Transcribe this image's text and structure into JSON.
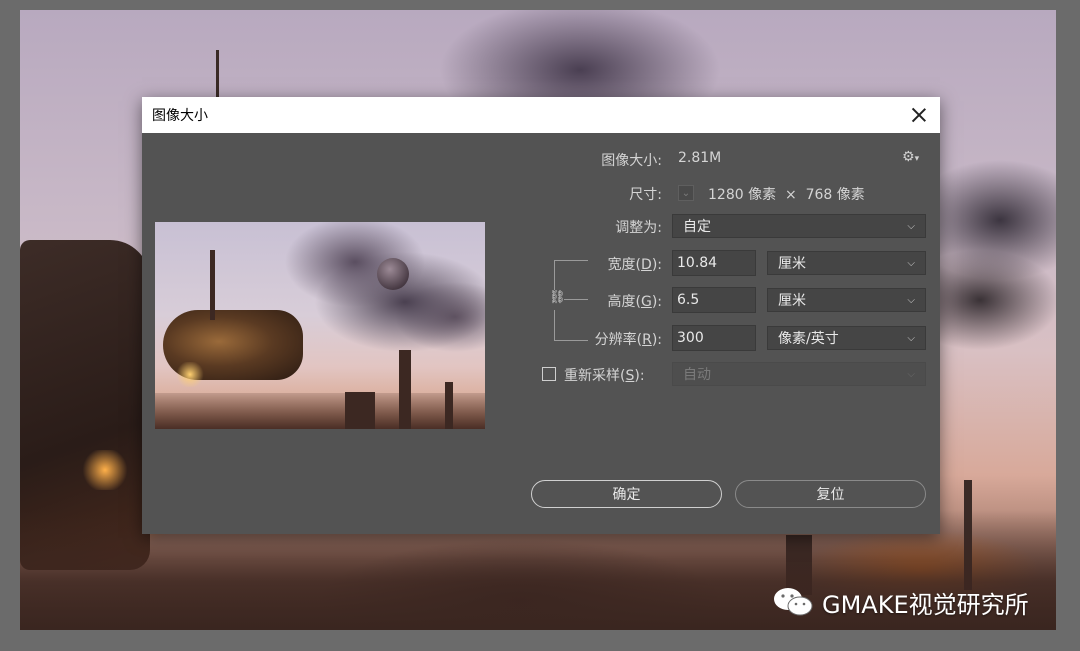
{
  "dialog": {
    "title": "图像大小",
    "image_size_label": "图像大小:",
    "image_size_value": "2.81M",
    "dimensions_label": "尺寸:",
    "dimensions_value": "1280 像素  ×  768 像素",
    "fit_to_label": "调整为:",
    "fit_to_value": "自定",
    "width_label_pre": "宽度(",
    "width_key": "D",
    "width_label_post": "):",
    "width_value": "10.84",
    "width_unit": "厘米",
    "height_label_pre": "高度(",
    "height_key": "G",
    "height_label_post": "):",
    "height_value": "6.5",
    "height_unit": "厘米",
    "resolution_label_pre": "分辨率(",
    "resolution_key": "R",
    "resolution_label_post": "):",
    "resolution_value": "300",
    "resolution_unit": "像素/英寸",
    "resample_label_pre": "重新采样(",
    "resample_key": "S",
    "resample_label_post": "):",
    "resample_value": "自动",
    "resample_checked": false,
    "ok_label": "确定",
    "reset_label": "复位"
  },
  "watermark": {
    "text": "GMAKE视觉研究所",
    "icon": "wechat-icon"
  },
  "icons": {
    "close": "close-icon",
    "gear": "gear-icon",
    "link": "chain-link-icon",
    "dropdown": "chevron-down-icon"
  }
}
